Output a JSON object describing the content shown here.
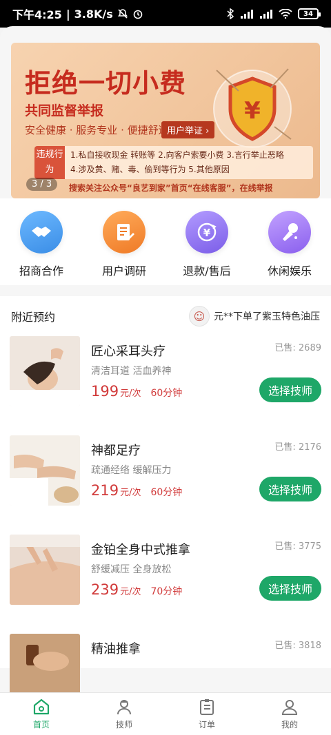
{
  "statusbar": {
    "time": "下午4:25",
    "speed": "3.8K/s",
    "battery": "34"
  },
  "banner": {
    "title": "拒绝一切小费",
    "subtitle": "共同监督举报",
    "line": "安全健康 · 服务专业 · 便捷舒适",
    "report_button": "用户举证 ›",
    "violation_tag": "违规行为",
    "violation_line1": "1.私自接收现金 转账等  2.向客户索要小费  3.言行举止恶略",
    "violation_line2": "4.涉及黄、赌、毒、偷到等行为  5.其他原因",
    "footer": "搜索关注公众号“良艺到家”首页“在线客服”，在线举报",
    "index": "3 / 3"
  },
  "entries": [
    {
      "label": "招商合作",
      "icon": "handshake-icon",
      "color": "#4aa3f0"
    },
    {
      "label": "用户调研",
      "icon": "document-pen-icon",
      "color": "#f58a3a"
    },
    {
      "label": "退款/售后",
      "icon": "refund-icon",
      "color": "#8d6ff0"
    },
    {
      "label": "休闲娱乐",
      "icon": "microphone-icon",
      "color": "#9d6ff2"
    }
  ],
  "nearby": {
    "title": "附近预约",
    "notice": "元**下单了紫玉特色油压"
  },
  "items": [
    {
      "name": "匠心采耳头疗",
      "desc": "清洁耳道 活血养神",
      "price": "199",
      "unit": "元/次",
      "duration": "60分钟",
      "sold": "已售: 2689",
      "button": "选择技师"
    },
    {
      "name": "神都足疗",
      "desc": "疏通经络 缓解压力",
      "price": "219",
      "unit": "元/次",
      "duration": "60分钟",
      "sold": "已售: 2176",
      "button": "选择技师"
    },
    {
      "name": "金铂全身中式推拿",
      "desc": "舒缓减压 全身放松",
      "price": "239",
      "unit": "元/次",
      "duration": "70分钟",
      "sold": "已售: 3775",
      "button": "选择技师"
    },
    {
      "name": "精油推拿",
      "desc": "",
      "price": "",
      "unit": "",
      "duration": "",
      "sold": "已售: 3818",
      "button": ""
    }
  ],
  "tabs": [
    {
      "label": "首页",
      "icon": "home-icon",
      "active": true
    },
    {
      "label": "技师",
      "icon": "technician-icon",
      "active": false
    },
    {
      "label": "订单",
      "icon": "order-icon",
      "active": false
    },
    {
      "label": "我的",
      "icon": "profile-icon",
      "active": false
    }
  ],
  "colors": {
    "accent": "#1ea768",
    "price": "#d13a3a",
    "banner_red": "#c62b1e"
  }
}
